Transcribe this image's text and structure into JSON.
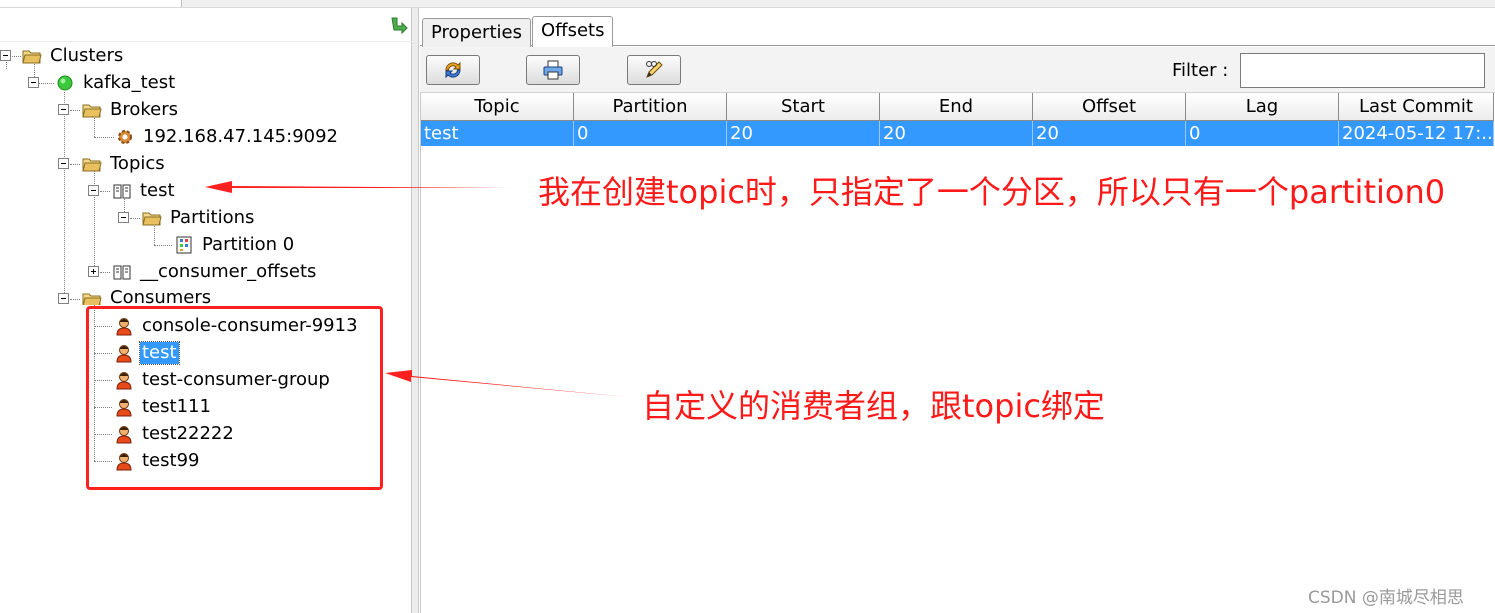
{
  "colors": {
    "selection": "#3399ff",
    "annotation": "#ff1a1a",
    "folder": "#e8c060",
    "connected": "#3cc93c"
  },
  "tree": {
    "clusters": "Clusters",
    "cluster_name": "kafka_test",
    "brokers": "Brokers",
    "broker_address": "192.168.47.145:9092",
    "topics": "Topics",
    "topic_test": "test",
    "partitions": "Partitions",
    "partition_0": "Partition 0",
    "consumer_offsets_topic": "__consumer_offsets",
    "consumers": "Consumers",
    "consumer_groups": [
      "console-consumer-9913",
      "test",
      "test-consumer-group",
      "test111",
      "test22222",
      "test99"
    ],
    "selected_consumer": "test"
  },
  "tabs": {
    "properties": "Properties",
    "offsets": "Offsets",
    "active": "Offsets"
  },
  "toolbar": {
    "icons": [
      "refresh-icon",
      "print-icon",
      "edit-icon"
    ]
  },
  "filter": {
    "label": "Filter :",
    "value": ""
  },
  "table": {
    "columns": [
      "Topic",
      "Partition",
      "Start",
      "End",
      "Offset",
      "Lag",
      "Last Commit"
    ],
    "rows": [
      [
        "test",
        "0",
        "20",
        "20",
        "20",
        "0",
        "2024-05-12 17:..."
      ]
    ]
  },
  "annotations": {
    "partition_note": "我在创建topic时，只指定了一个分区，所以只有一个partition0",
    "consumer_group_note": "自定义的消费者组，跟topic绑定"
  },
  "watermark": "CSDN @南城尽相思"
}
